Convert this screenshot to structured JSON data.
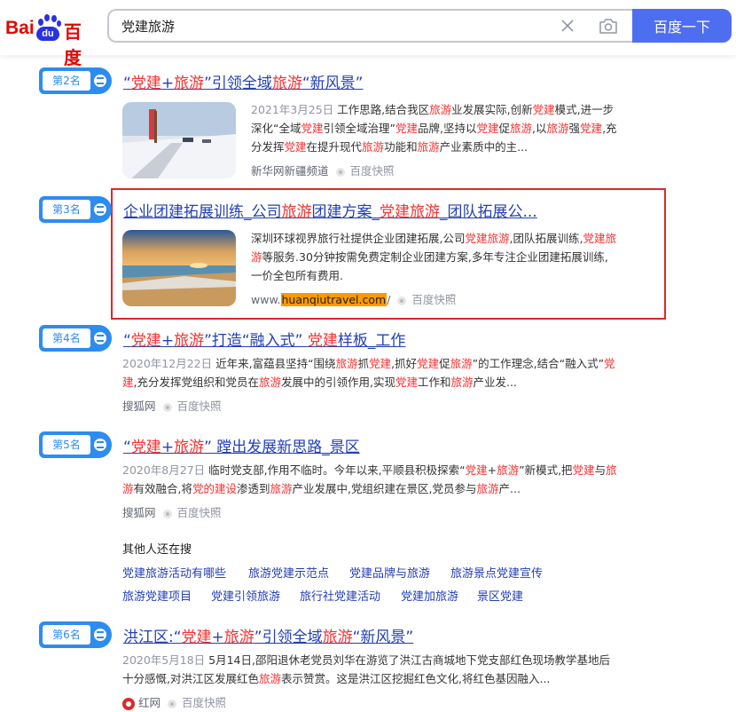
{
  "header": {
    "logo": {
      "bai": "Bai",
      "du_char": "du",
      "du_cn": "百度"
    },
    "search_query": "党建旅游",
    "search_button": "百度一下"
  },
  "results": [
    {
      "rank": "第2名",
      "title_parts": [
        "“",
        "党建",
        "+",
        "旅游",
        "”引领全域",
        "旅游",
        "“新风景”"
      ],
      "date": "2021年3月25日",
      "snippet_parts": [
        " 工作思路,结合我区",
        "旅游",
        "业发展实际,创新",
        "党建",
        "模式,进一步深化“全域",
        "党建",
        "引领全域治理”",
        "党建",
        "品牌,坚持以",
        "党建",
        "促",
        "旅游",
        ",以",
        "旅游",
        "强",
        "党建",
        ",充分发挥",
        "党建",
        "在提升现代",
        "旅游",
        "功能和",
        "旅游",
        "产业素质中的主..."
      ],
      "source": "新华网新疆频道",
      "snapshot": "百度快照"
    },
    {
      "rank": "第3名",
      "title_parts": [
        "企业团建拓展训练_公司",
        "旅游",
        "团建方案_",
        "党建旅游",
        "_团队拓展公..."
      ],
      "snippet_parts": [
        "深圳环球视界旅行社提供企业团建拓展,公司",
        "党建旅游",
        ",团队拓展训练,",
        "党建旅游",
        "等服务.30分钟按需免费定制企业团建方案,多年专注企业团建拓展训练,一价全包所有费用."
      ],
      "url_prefix": "www.",
      "url_highlight": "huanqiutravel.com",
      "url_suffix": "/",
      "snapshot": "百度快照"
    },
    {
      "rank": "第4名",
      "title_parts": [
        "“",
        "党建",
        "+",
        "旅游",
        "”打造“融入式” ",
        "党建",
        "样板_工作"
      ],
      "date": "2020年12月22日",
      "snippet_parts": [
        " 近年来,富蕴县坚持“围绕",
        "旅游",
        "抓",
        "党建",
        ",抓好",
        "党建",
        "促",
        "旅游",
        "”的工作理念,结合“融入式”",
        "党建",
        ",充分发挥党组织和党员在",
        "旅游",
        "发展中的引领作用,实现",
        "党建",
        "工作和",
        "旅游",
        "产业发..."
      ],
      "source": "搜狐网",
      "snapshot": "百度快照"
    },
    {
      "rank": "第5名",
      "title_parts": [
        "“",
        "党建",
        "+",
        "旅游",
        "” 蹚出发展新思路_景区"
      ],
      "date": "2020年8月27日",
      "snippet_parts": [
        " 临时党支部,作用不临时。今年以来,平顺县积极探索“",
        "党建",
        "+",
        "旅游",
        "”新模式,把",
        "党建",
        "与",
        "旅游",
        "有效融合,将",
        "党的建设",
        "渗透到",
        "旅游",
        "产业发展中,党组织建在景区,党员参与",
        "旅游",
        "产..."
      ],
      "source": "搜狐网",
      "snapshot": "百度快照"
    },
    {
      "rank": "第6名",
      "title_parts": [
        "洪江区:“",
        "党建",
        "+",
        "旅游",
        "”引领全域",
        "旅游",
        "“新风景”"
      ],
      "date": "2020年5月18日",
      "snippet_parts": [
        " 5月14日,邵阳退休老党员刘华在游览了洪江古商城地下党支部红色现场教学基地后十分感慨,对洪江区发展红色",
        "旅游",
        "表示赞赏。这是洪江区挖掘红色文化,将红色基因融入..."
      ],
      "source": "红网",
      "snapshot": "百度快照"
    }
  ],
  "related": {
    "title": "其他人还在搜",
    "row1": [
      "党建旅游活动有哪些",
      "旅游党建示范点",
      "党建品牌与旅游",
      "旅游景点党建宣传"
    ],
    "row2": [
      "旅游党建项目",
      "党建引领旅游",
      "旅行社党建活动",
      "党建加旅游",
      "景区党建"
    ]
  },
  "colors": {
    "link": "#2440b3",
    "highlight": "#f73131",
    "brand_blue": "#4e6ef2",
    "rank_blue": "#2d8cf0",
    "ad_border": "#e0262b",
    "url_highlight": "#ff9900"
  },
  "icons": [
    "clear-icon",
    "camera-icon",
    "snapshot-icon",
    "rank-arrow-icon",
    "hongwang-icon"
  ]
}
